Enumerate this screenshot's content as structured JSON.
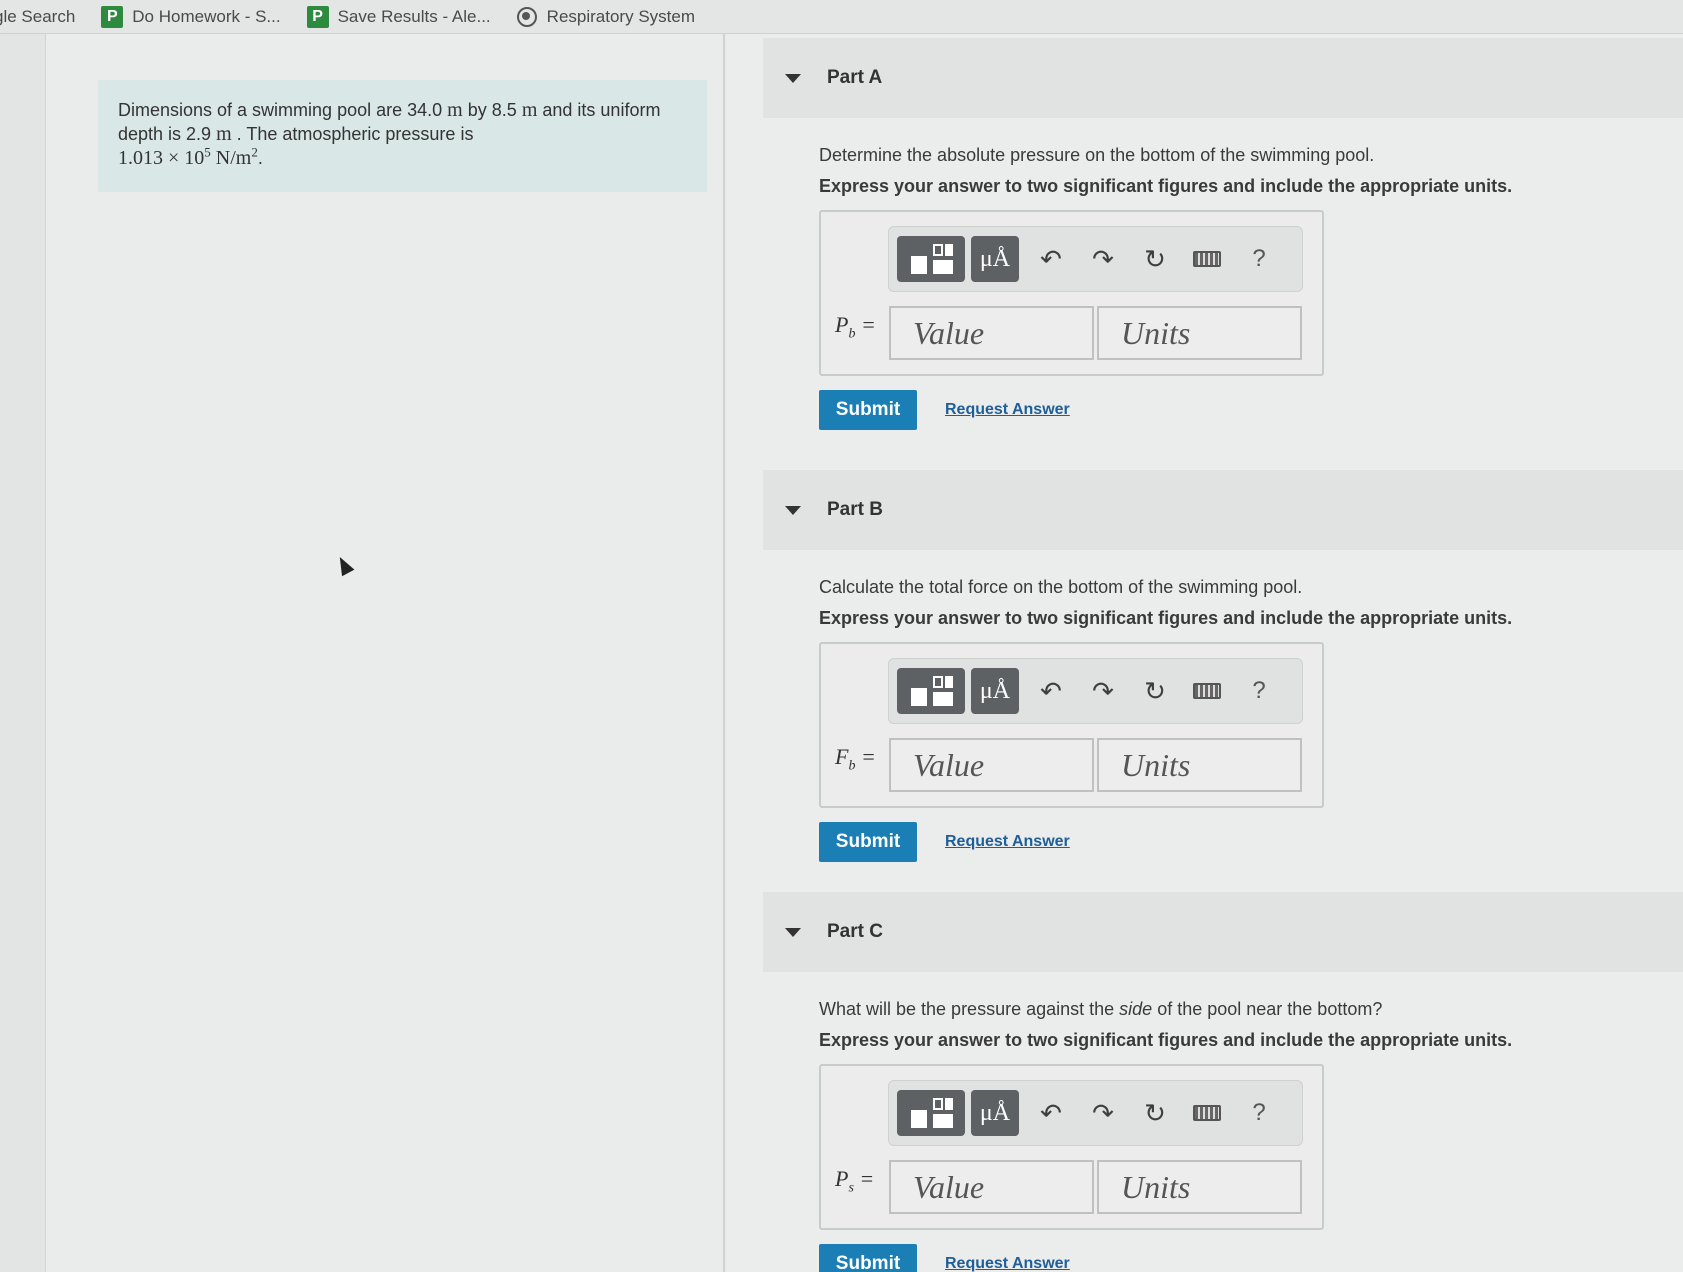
{
  "bookmarks": [
    {
      "label": "gle Search"
    },
    {
      "label": "Do Homework - S..."
    },
    {
      "label": "Save Results - Ale..."
    },
    {
      "label": "Respiratory System"
    }
  ],
  "problem": {
    "text1": "Dimensions of a swimming pool are 34.0",
    "unit_m1": "m",
    "text2": "by 8.5",
    "unit_m2": "m",
    "text3": "and its uniform depth is 2.9",
    "unit_m3": "m",
    "text4": ". The atmospheric pressure is",
    "pressure_mantissa": "1.013 × 10",
    "pressure_exp": "5",
    "pressure_unit": "N/m",
    "pressure_unit_exp": "2",
    "end": "."
  },
  "toolbar": {
    "units_label": "μÅ",
    "undo_icon": "↶",
    "redo_icon": "↷",
    "reset_icon": "↻",
    "help_label": "?"
  },
  "parts": [
    {
      "title": "Part A",
      "question_pre": "Determine the absolute pressure on the bottom of the swimming pool.",
      "instruction": "Express your answer to two significant figures and include the appropriate units.",
      "var_symbol": "P",
      "var_sub": "b",
      "var_eq": " =",
      "value_placeholder": "Value",
      "units_placeholder": "Units",
      "submit_label": "Submit",
      "request_label": "Request Answer"
    },
    {
      "title": "Part B",
      "question_pre": "Calculate the total force on the bottom of the swimming pool.",
      "instruction": "Express your answer to two significant figures and include the appropriate units.",
      "var_symbol": "F",
      "var_sub": "b",
      "var_eq": " =",
      "value_placeholder": "Value",
      "units_placeholder": "Units",
      "submit_label": "Submit",
      "request_label": "Request Answer"
    },
    {
      "title": "Part C",
      "question_pre": "What will be the pressure against the ",
      "question_em": "side",
      "question_post": " of the pool near the bottom?",
      "instruction": "Express your answer to two significant figures and include the appropriate units.",
      "var_symbol": "P",
      "var_sub": "s",
      "var_eq": " =",
      "value_placeholder": "Value",
      "units_placeholder": "Units",
      "submit_label": "Submit",
      "request_label": "Request Answer"
    }
  ]
}
